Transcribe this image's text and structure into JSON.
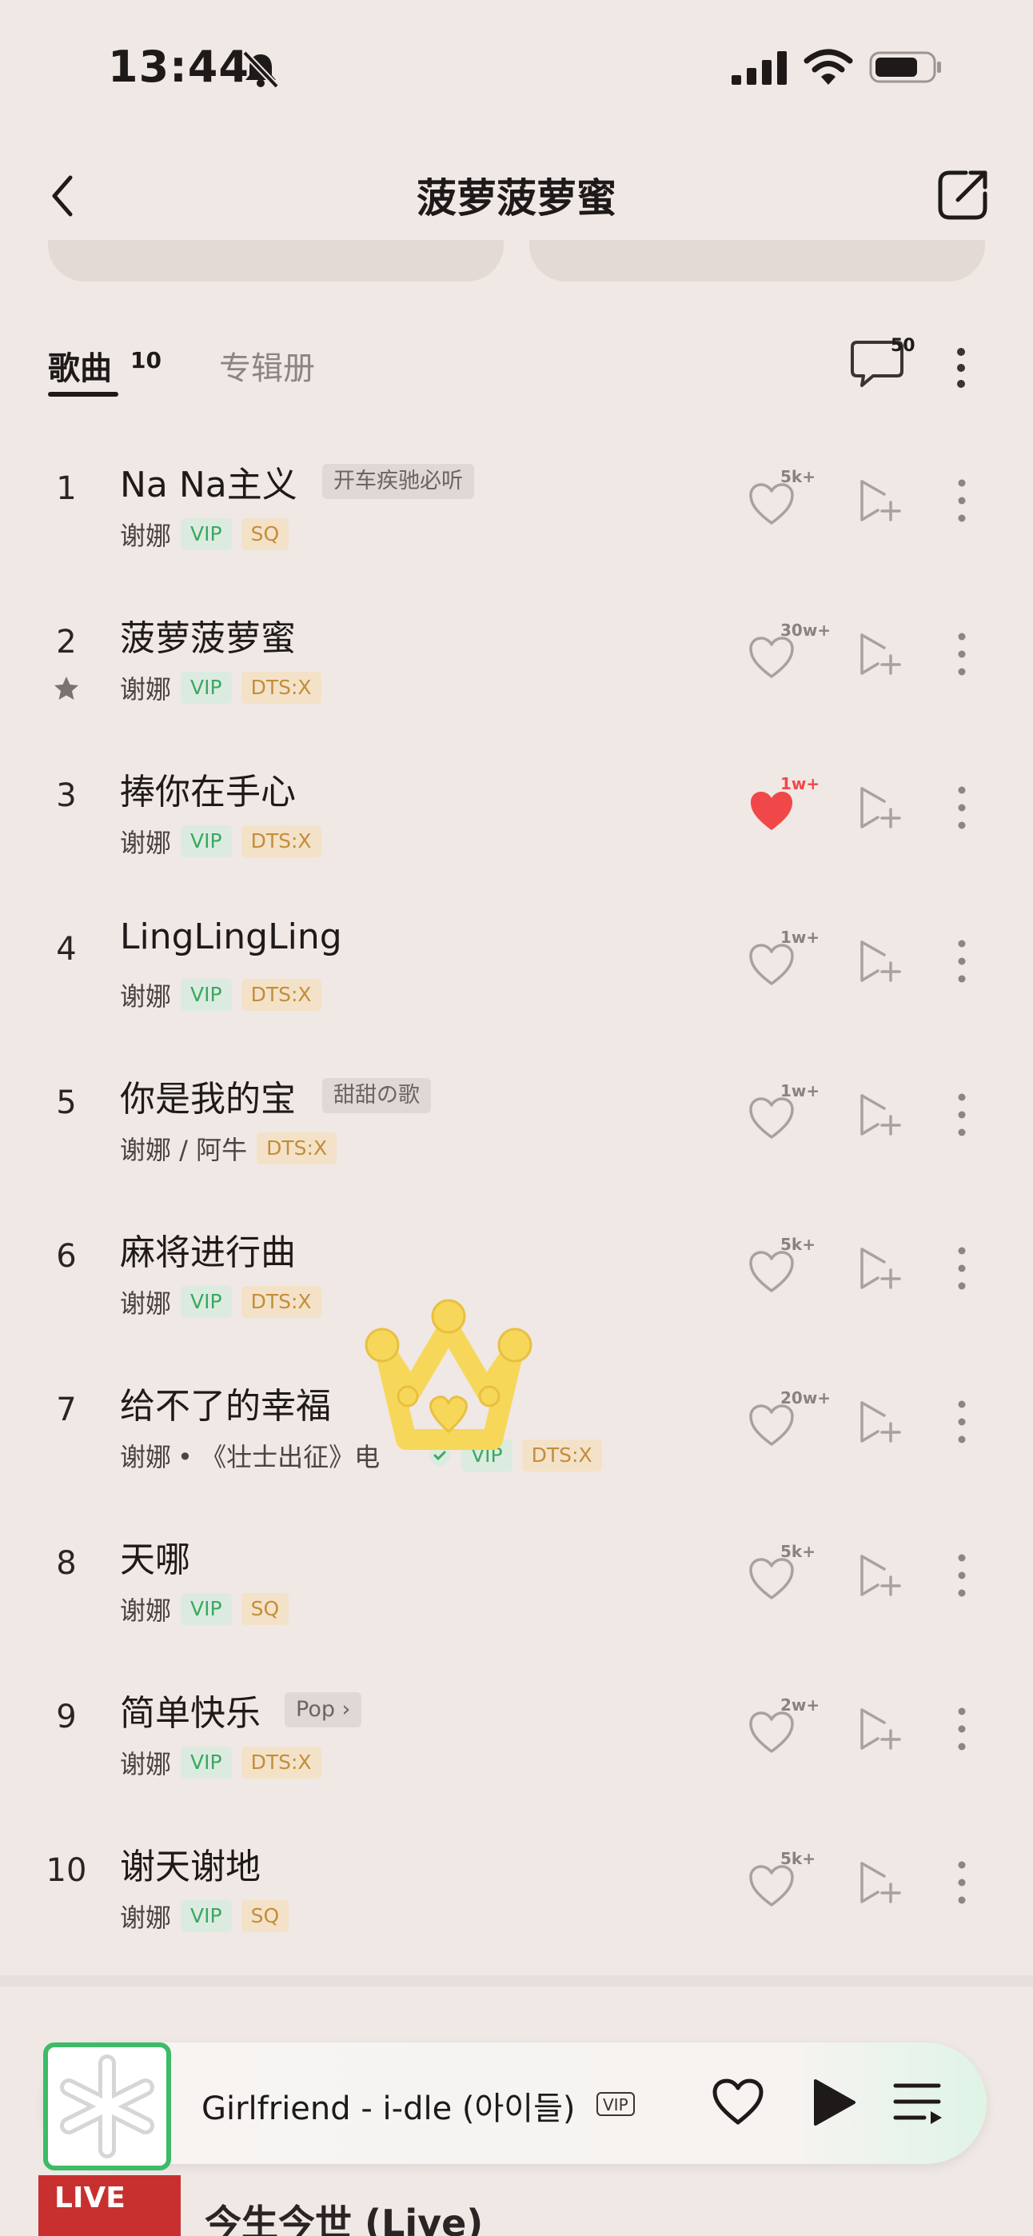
{
  "status": {
    "time": "13:44"
  },
  "header": {
    "title": "菠萝菠萝蜜"
  },
  "tabs": {
    "songs_label": "歌曲",
    "songs_count": "10",
    "albums_label": "专辑册",
    "comment_count": "50"
  },
  "songs": [
    {
      "num": "1",
      "title": "Na Na主义",
      "tag": "开车疾驰必听",
      "artist": "谢娜",
      "vip": "VIP",
      "quality": "SQ",
      "likes": "5k+",
      "liked": false
    },
    {
      "num": "2",
      "title": "菠萝菠萝蜜",
      "artist": "谢娜",
      "vip": "VIP",
      "quality": "DTS:X",
      "likes": "30w+",
      "liked": false,
      "starred": true
    },
    {
      "num": "3",
      "title": "捧你在手心",
      "artist": "谢娜",
      "vip": "VIP",
      "quality": "DTS:X",
      "likes": "1w+",
      "liked": true
    },
    {
      "num": "4",
      "title": "LingLingLing",
      "artist": "谢娜",
      "vip": "VIP",
      "quality": "DTS:X",
      "likes": "1w+",
      "liked": false
    },
    {
      "num": "5",
      "title": "你是我的宝",
      "tag": "甜甜の歌",
      "artist": "谢娜 / 阿牛",
      "quality": "DTS:X",
      "likes": "1w+",
      "liked": false
    },
    {
      "num": "6",
      "title": "麻将进行曲",
      "artist": "谢娜",
      "vip": "VIP",
      "quality": "DTS:X",
      "likes": "5k+",
      "liked": false
    },
    {
      "num": "7",
      "title": "给不了的幸福",
      "artist": "谢娜",
      "album": " • 《壮士出征》电",
      "vip": "VIP",
      "quality": "DTS:X",
      "likes": "20w+",
      "liked": false
    },
    {
      "num": "8",
      "title": "天哪",
      "artist": "谢娜",
      "vip": "VIP",
      "quality": "SQ",
      "likes": "5k+",
      "liked": false
    },
    {
      "num": "9",
      "title": "简单快乐",
      "tag": "Pop ›",
      "artist": "谢娜",
      "vip": "VIP",
      "quality": "DTS:X",
      "likes": "2w+",
      "liked": false
    },
    {
      "num": "10",
      "title": "谢天谢地",
      "artist": "谢娜",
      "vip": "VIP",
      "quality": "SQ",
      "likes": "5k+",
      "liked": false
    }
  ],
  "behind": {
    "cover_text": "LIVE",
    "song": "今生今世 (Live)"
  },
  "player": {
    "title": "Girlfriend - i-dle (아이들)",
    "vip": "VIP"
  },
  "colors": {
    "background": "#efe8e5",
    "vip_green": "#3aa861",
    "quality_gold": "#c48d3a",
    "liked_red": "#f04848",
    "player_border": "#3dbb68",
    "crown_yellow": "#f7d75a"
  }
}
